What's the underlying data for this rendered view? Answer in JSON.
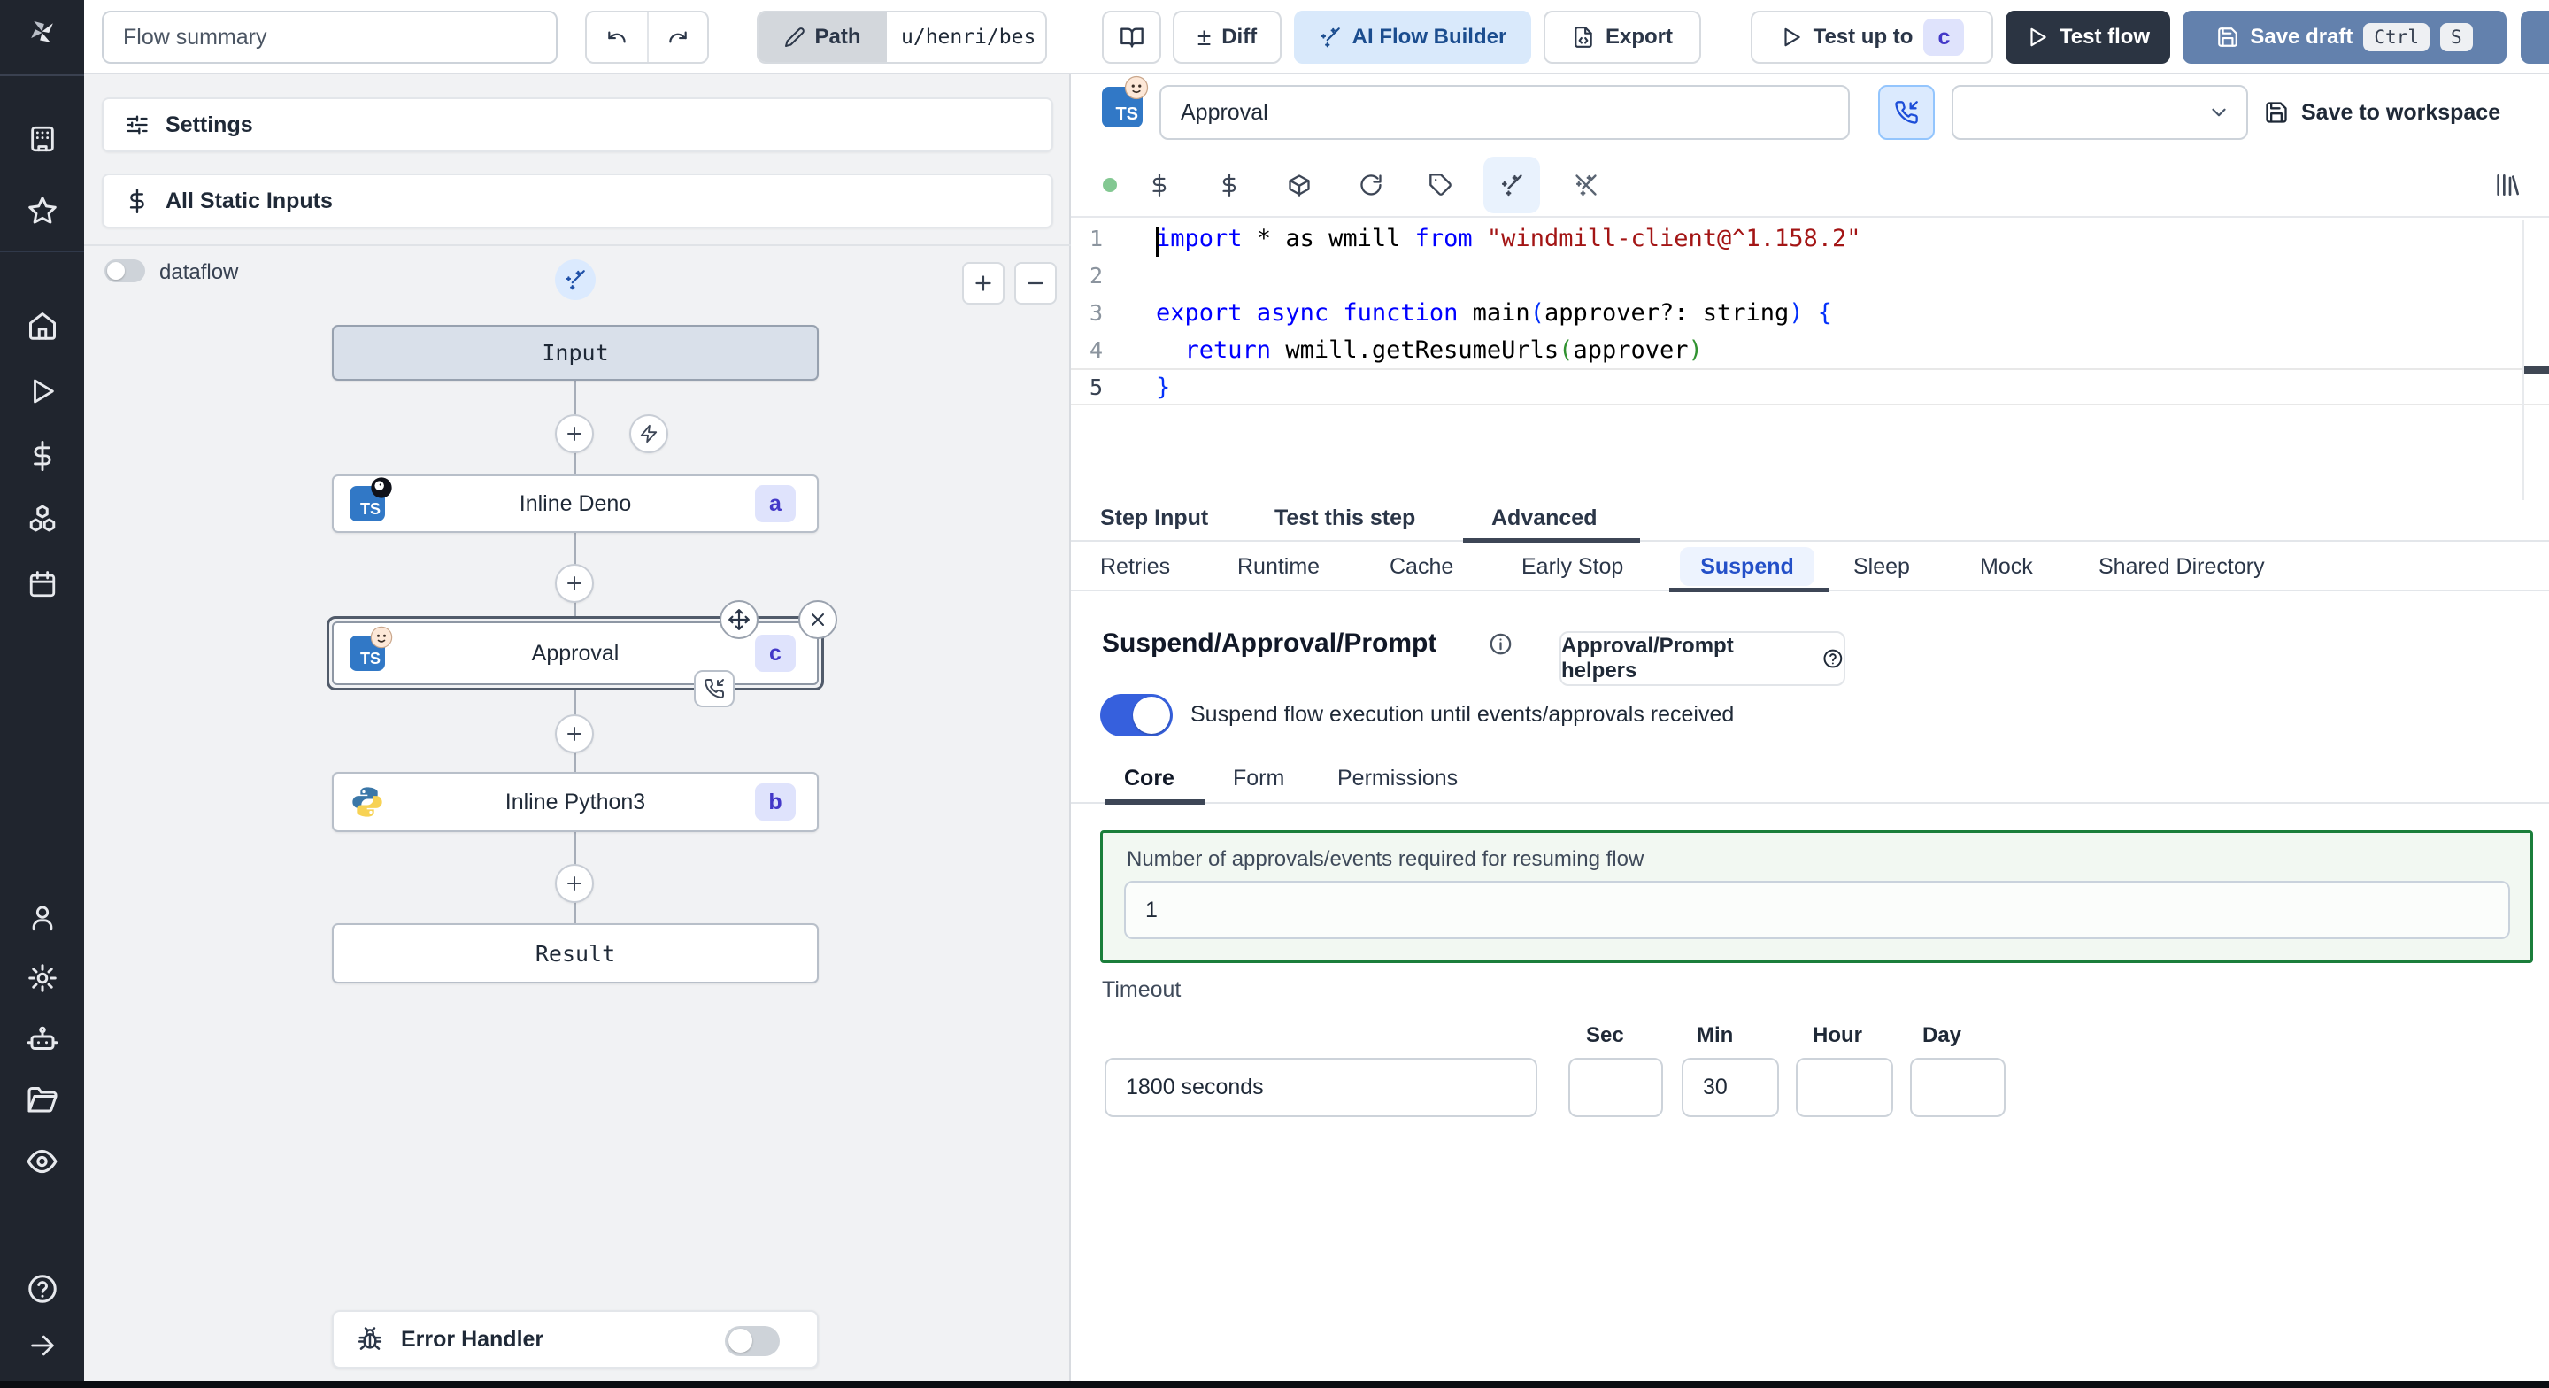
{
  "topbar": {
    "flow_summary": "Flow summary",
    "path_label": "Path",
    "path_value": "u/henri/bes",
    "diff_label": "Diff",
    "ai_flow_builder_label": "AI Flow Builder",
    "export_label": "Export",
    "test_up_to_label": "Test up to",
    "test_up_to_badge": "c",
    "test_flow_label": "Test flow",
    "save_draft_label": "Save draft",
    "save_draft_kbd": [
      "Ctrl",
      "S"
    ]
  },
  "flow_panel": {
    "settings_label": "Settings",
    "static_inputs_label": "All Static Inputs",
    "dataflow_label": "dataflow",
    "nodes": {
      "input_label": "Input",
      "deno": {
        "label": "Inline Deno",
        "badge": "a"
      },
      "approval": {
        "label": "Approval",
        "badge": "c"
      },
      "python": {
        "label": "Inline Python3",
        "badge": "b"
      },
      "result_label": "Result"
    },
    "error_handler_label": "Error Handler"
  },
  "step_panel": {
    "title_value": "Approval",
    "save_to_workspace_label": "Save to workspace",
    "tabs": [
      "Step Input",
      "Test this step",
      "Advanced"
    ],
    "subtabs": [
      "Retries",
      "Runtime",
      "Cache",
      "Early Stop",
      "Suspend",
      "Sleep",
      "Mock",
      "Shared Directory"
    ],
    "suspend": {
      "heading": "Suspend/Approval/Prompt",
      "helpers_button": "Approval/Prompt helpers",
      "toggle_label": "Suspend flow execution until events/approvals received",
      "tabs": [
        "Core",
        "Form",
        "Permissions"
      ],
      "approvals_label": "Number of approvals/events required for resuming flow",
      "approvals_value": "1",
      "timeout_label": "Timeout",
      "timeout_value": "1800 seconds",
      "units": [
        {
          "label": "Sec",
          "value": ""
        },
        {
          "label": "Min",
          "value": "30"
        },
        {
          "label": "Hour",
          "value": ""
        },
        {
          "label": "Day",
          "value": ""
        }
      ]
    }
  },
  "code": {
    "lines": [
      {
        "n": "1",
        "tokens": [
          {
            "t": "import",
            "c": "kw"
          },
          {
            "t": " * as wmill ",
            "c": "tx"
          },
          {
            "t": "from",
            "c": "kw"
          },
          {
            "t": " ",
            "c": "tx"
          },
          {
            "t": "\"windmill-client@^1.158.2\"",
            "c": "str"
          }
        ]
      },
      {
        "n": "2",
        "tokens": []
      },
      {
        "n": "3",
        "tokens": [
          {
            "t": "export",
            "c": "kw"
          },
          {
            "t": " ",
            "c": "tx"
          },
          {
            "t": "async",
            "c": "kw"
          },
          {
            "t": " ",
            "c": "tx"
          },
          {
            "t": "function",
            "c": "kw"
          },
          {
            "t": " main",
            "c": "tx"
          },
          {
            "t": "(",
            "c": "br1"
          },
          {
            "t": "approver?: string",
            "c": "tx"
          },
          {
            "t": ") {",
            "c": "br1"
          }
        ]
      },
      {
        "n": "4",
        "tokens": [
          {
            "t": "  ",
            "c": "tx"
          },
          {
            "t": "return",
            "c": "kw"
          },
          {
            "t": " wmill.getResumeUrls",
            "c": "tx"
          },
          {
            "t": "(",
            "c": "br2"
          },
          {
            "t": "approver",
            "c": "tx"
          },
          {
            "t": ")",
            "c": "br2"
          }
        ]
      },
      {
        "n": "5",
        "tokens": [
          {
            "t": "}",
            "c": "br1"
          }
        ],
        "current": true
      }
    ]
  },
  "icons": {
    "diff_glyph": "±",
    "ts_label": "TS"
  }
}
